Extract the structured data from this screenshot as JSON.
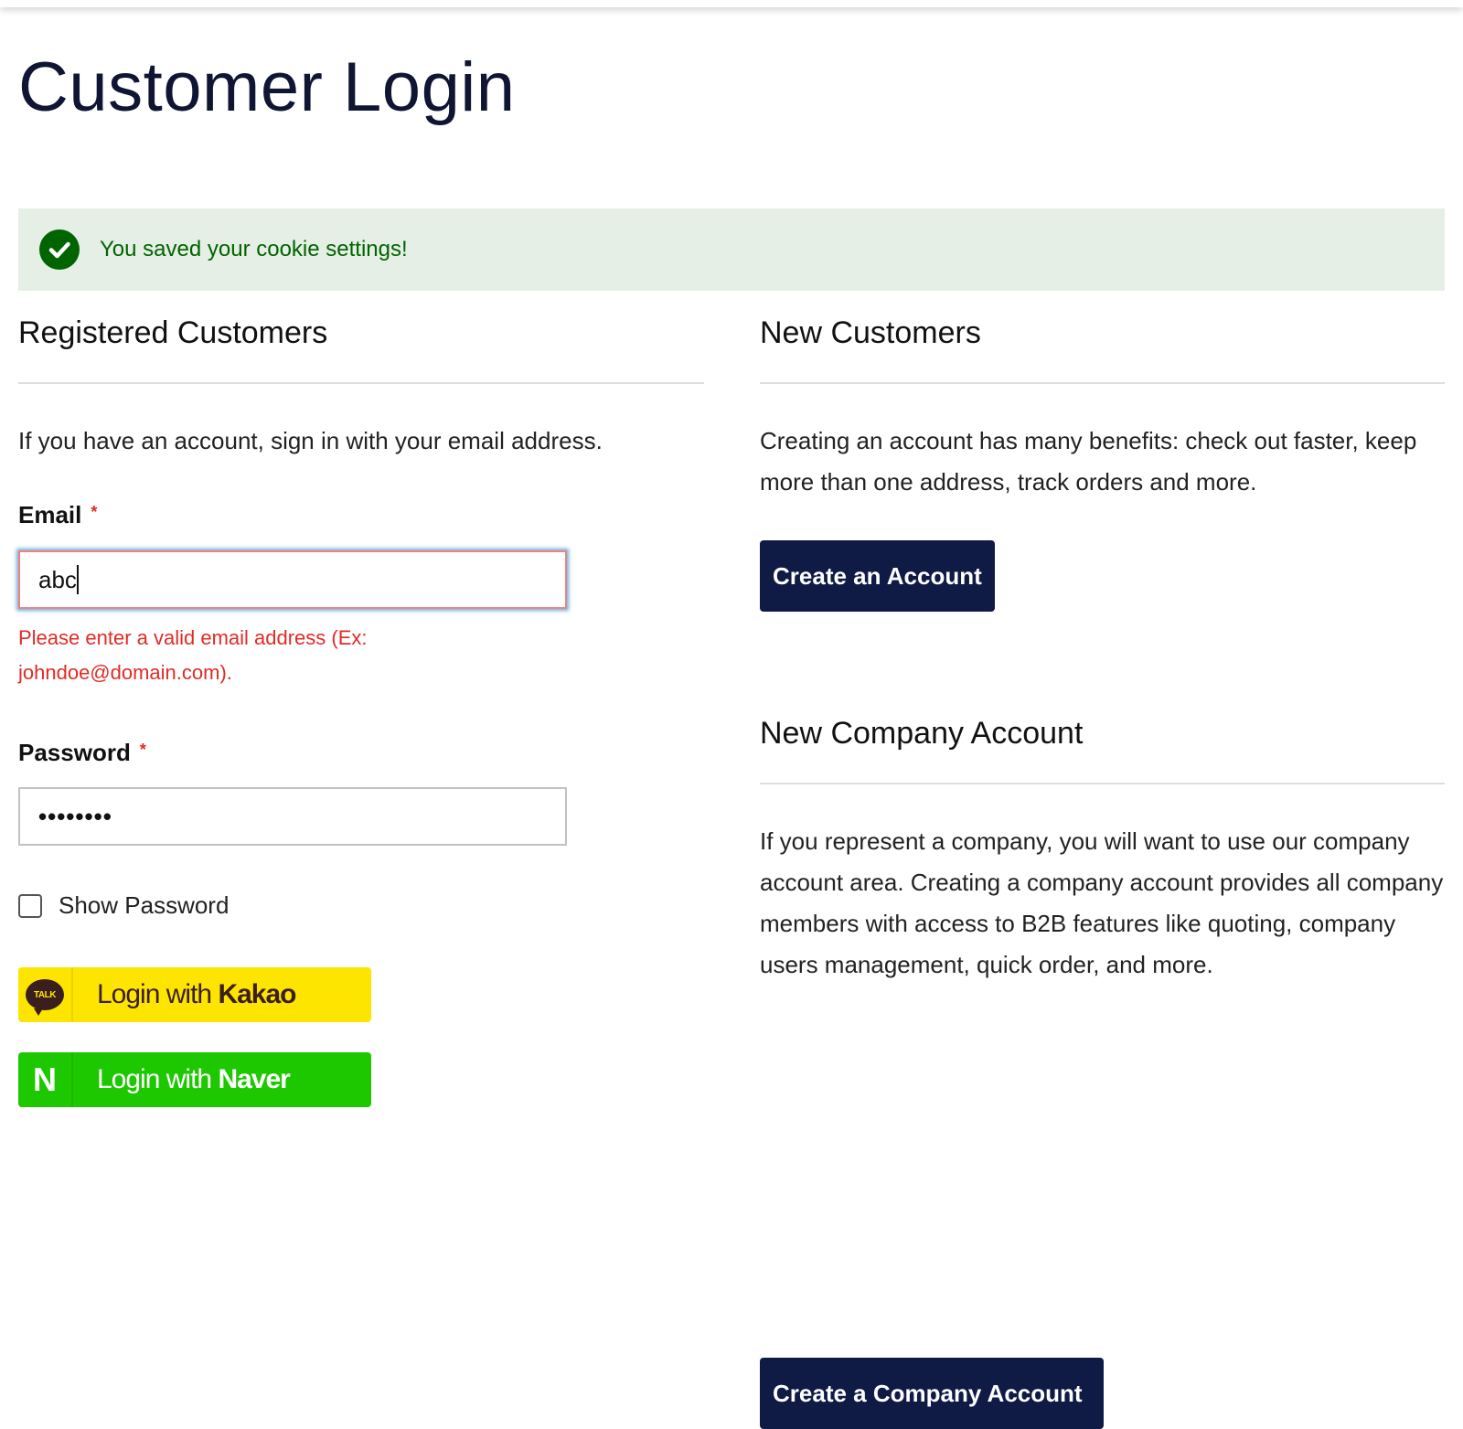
{
  "page": {
    "title": "Customer Login"
  },
  "message": {
    "text": "You saved your cookie settings!",
    "icon": "check-circle-icon",
    "color": "#006400",
    "background": "#e5efe5"
  },
  "registered": {
    "title": "Registered Customers",
    "intro": "If you have an account, sign in with your email address.",
    "email_label": "Email",
    "email_value": "abc",
    "email_error": "Please enter a valid email address (Ex: johndoe@domain.com).",
    "password_label": "Password",
    "password_value": "••••••••",
    "required_mark": "*",
    "show_password_label": "Show Password",
    "kakao": {
      "prefix": "Login with ",
      "brand": "Kakao",
      "icon_text": "TALK",
      "color": "#fee500"
    },
    "naver": {
      "prefix": "Login with ",
      "brand": "Naver",
      "icon_text": "N",
      "color": "#1ec800"
    }
  },
  "new_customers": {
    "title": "New Customers",
    "intro": "Creating an account has many benefits: check out faster, keep more than one address, track orders and more.",
    "button_label": "Create an Account"
  },
  "company": {
    "title": "New Company Account",
    "intro": "If you represent a company, you will want to use our company account area. Creating a company account provides all company members with access to B2B features like quoting, company users management, quick order, and more.",
    "button_label": "Create a Company Account"
  },
  "colors": {
    "primary_button": "#0f1a45",
    "error": "#e02b27"
  }
}
